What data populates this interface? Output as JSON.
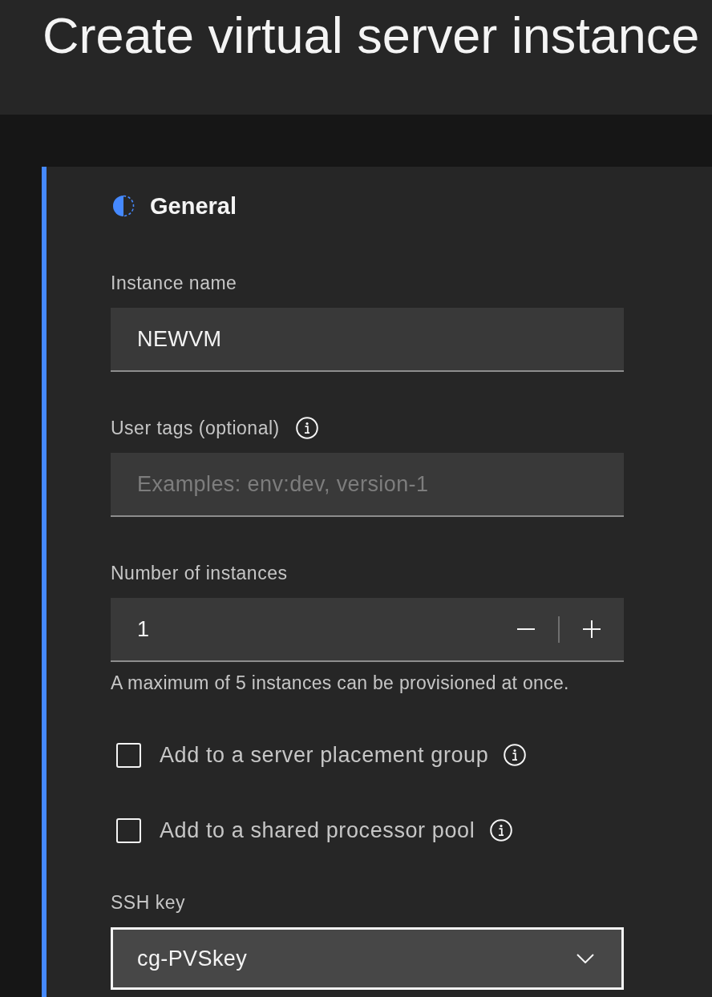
{
  "page_header": {
    "title": "Create virtual server instance"
  },
  "section": {
    "title": "General",
    "fields": [
      {
        "kind": "text",
        "label": "Instance name",
        "info": false,
        "value": "NEWVM"
      },
      {
        "kind": "text",
        "label": "User tags (optional)",
        "info": true,
        "placeholder": "Examples: env:dev, version-1"
      },
      {
        "kind": "number",
        "label": "Number of instances",
        "info": false,
        "value": "1",
        "helper": "A maximum of 5 instances can be provisioned at once."
      },
      {
        "kind": "checkbox",
        "label": "Add to a server placement group",
        "checked": false,
        "info": true
      },
      {
        "kind": "checkbox",
        "label": "Add to a shared processor pool",
        "checked": false,
        "info": true
      },
      {
        "kind": "select",
        "label": "SSH key",
        "info": false,
        "value": "cg-PVSkey",
        "focused": true
      }
    ]
  }
}
